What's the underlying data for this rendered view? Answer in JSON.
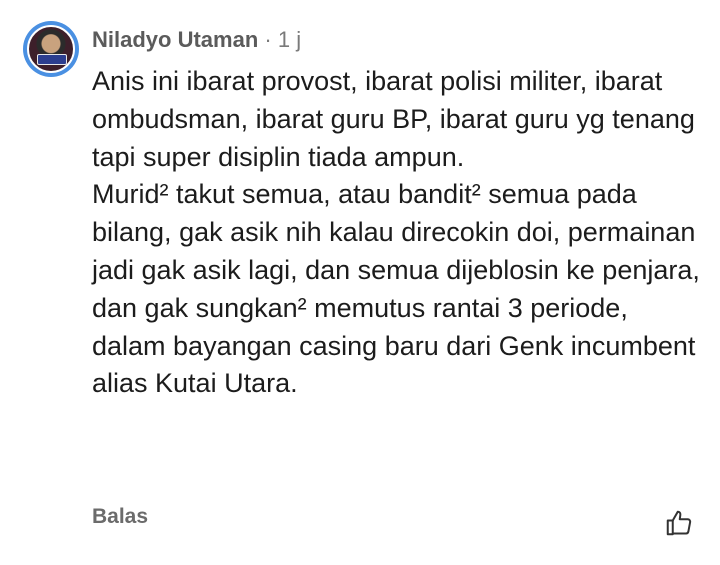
{
  "comment": {
    "author": "Niladyo Utaman",
    "separator": "·",
    "time": "1 j",
    "paragraphs": [
      "Anis ini ibarat provost, ibarat polisi militer, ibarat ombudsman, ibarat guru BP, ibarat guru yg tenang tapi super disiplin tiada ampun.",
      "Murid² takut semua, atau bandit² semua pada bilang, gak asik nih kalau direcokin doi, permainan jadi gak asik lagi, dan semua dijeblosin ke penjara, dan gak sungkan² memutus rantai 3 periode, dalam bayangan casing baru dari Genk incumbent alias Kutai Utara."
    ],
    "reply_label": "Balas",
    "like_icon": "thumbs-up-icon",
    "avatar_ring_color": "#4a90e2"
  }
}
